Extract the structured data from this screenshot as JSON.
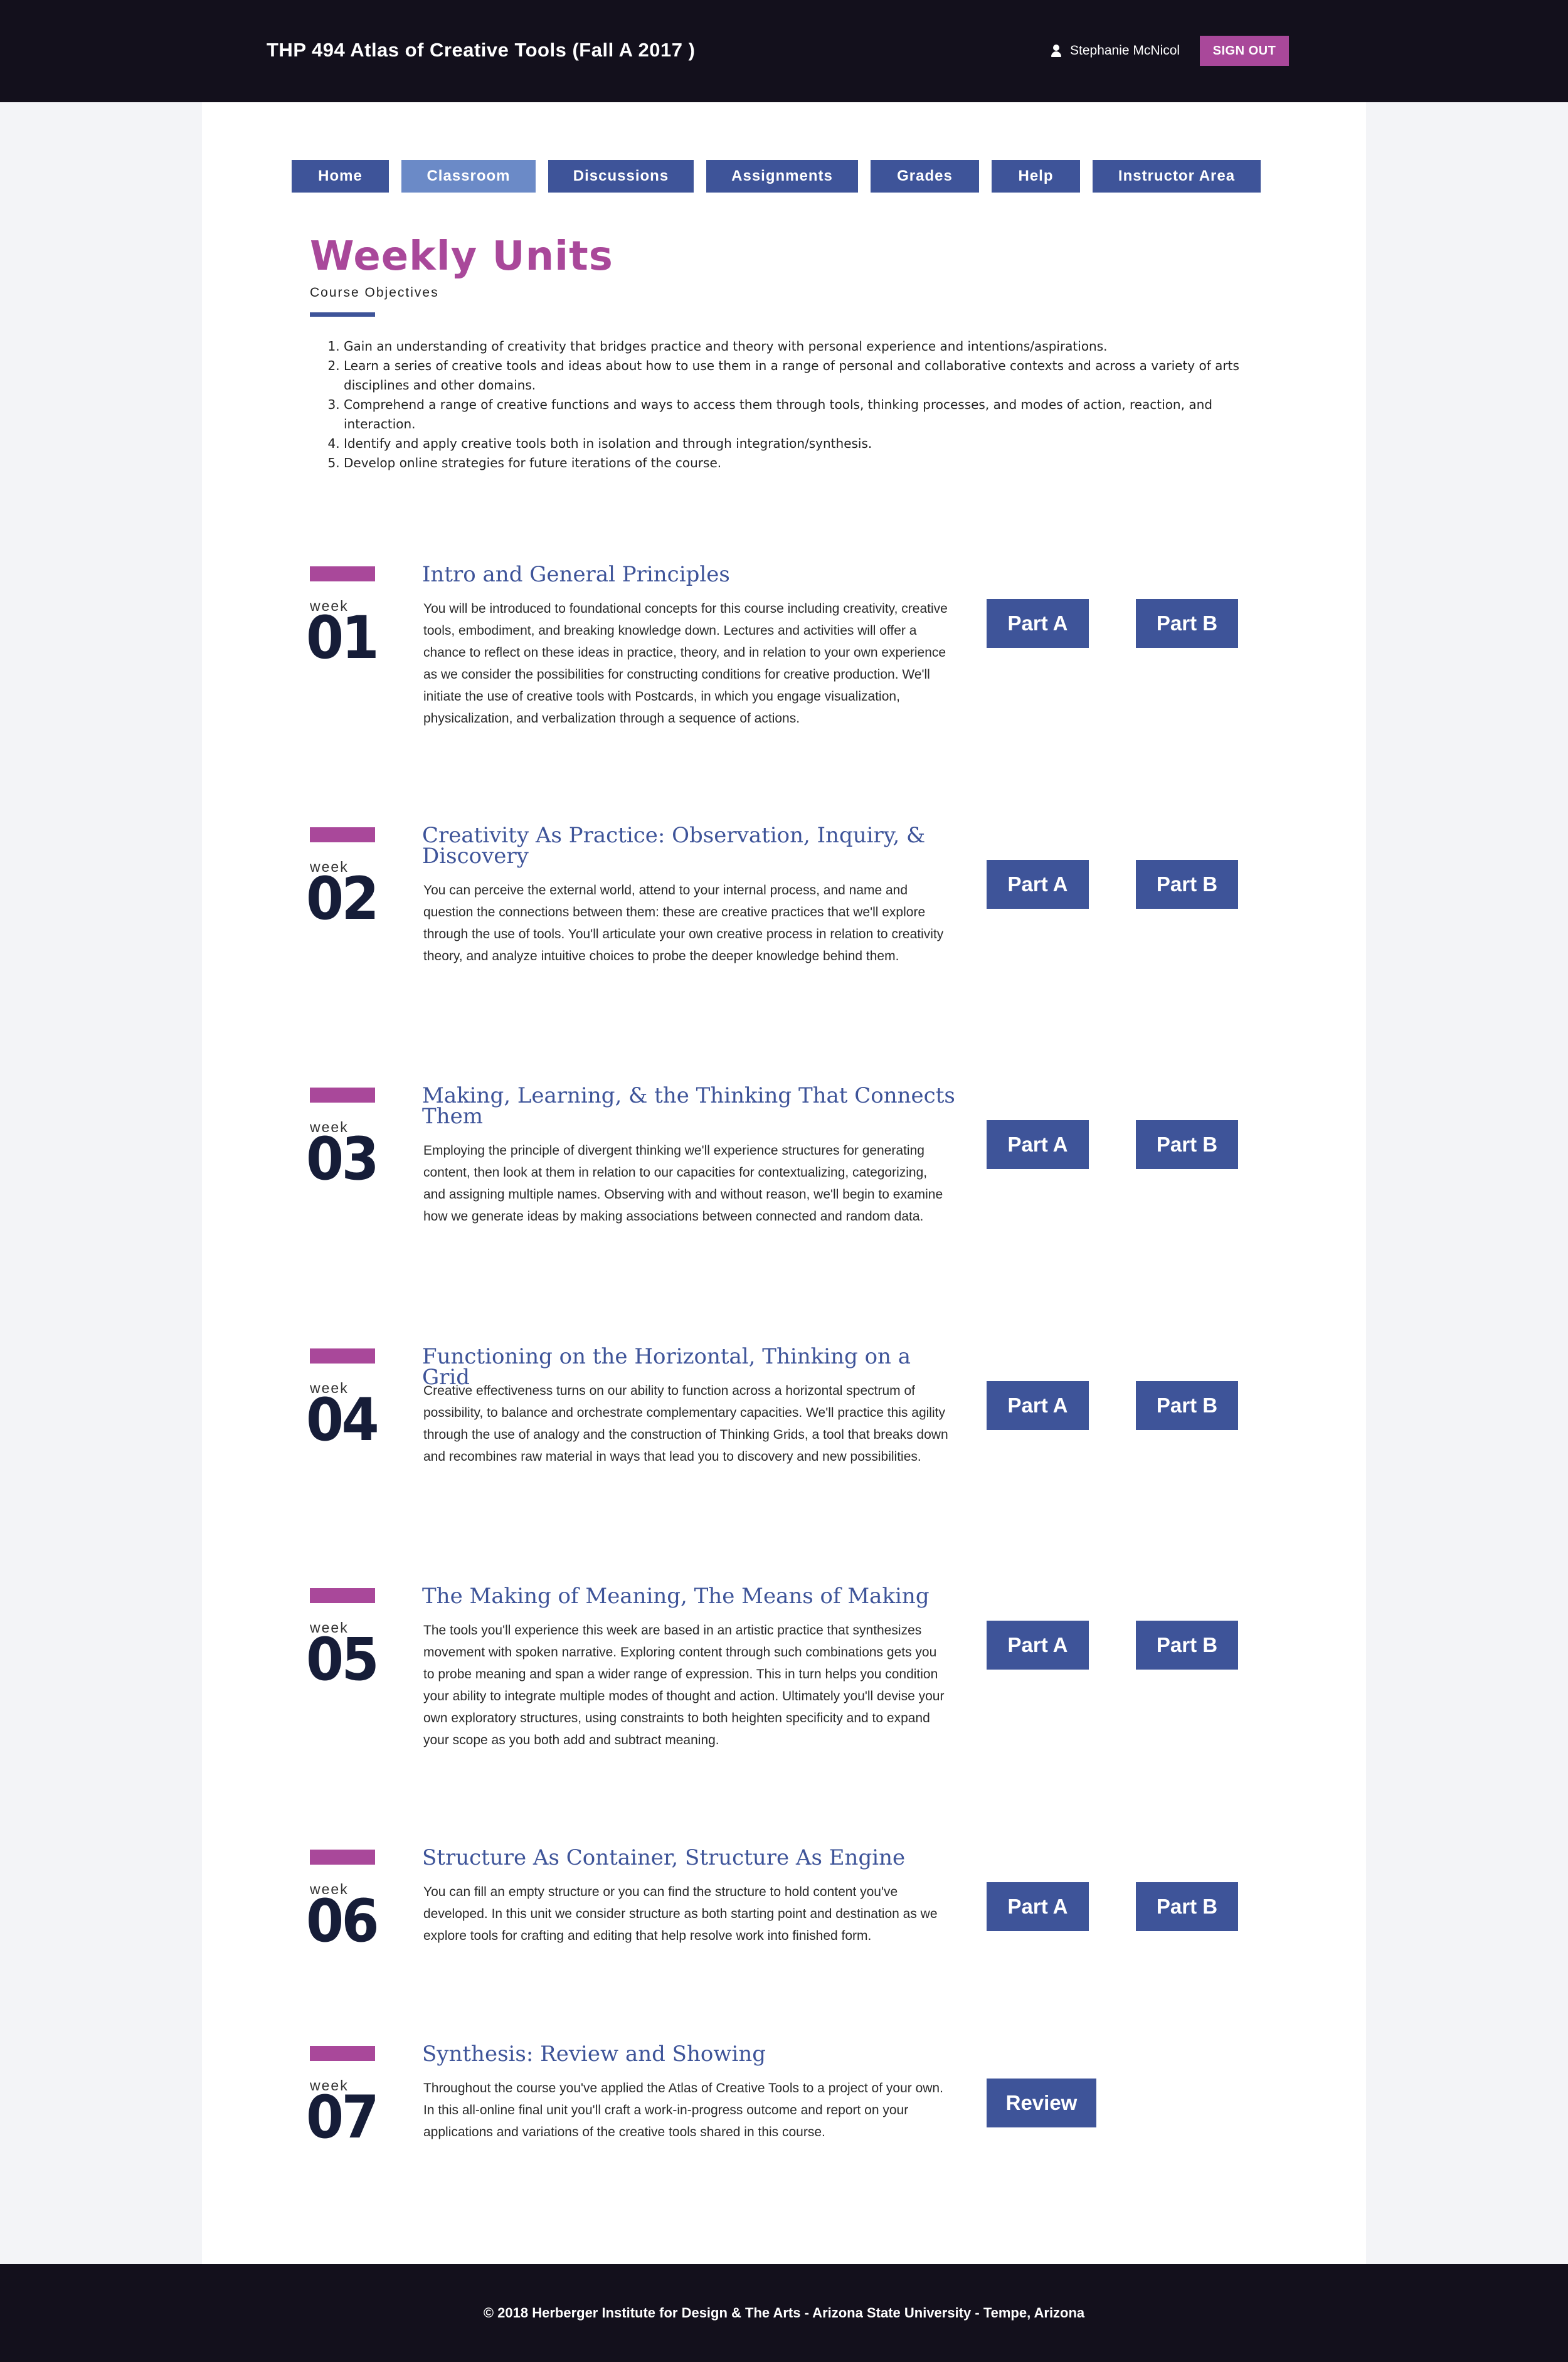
{
  "header": {
    "course_title": "THP 494 Atlas of Creative Tools (Fall A 2017 )",
    "user_name": "Stephanie McNicol",
    "user_icon": "user-icon",
    "sign_out_label": "SIGN OUT"
  },
  "nav": {
    "items": [
      "Home",
      "Classroom",
      "Discussions",
      "Assignments",
      "Grades",
      "Help",
      "Instructor Area"
    ],
    "active": "Classroom"
  },
  "page": {
    "title": "Weekly Units",
    "subtitle": "Course Objectives",
    "objectives": [
      "Gain an understanding of creativity that bridges practice and theory with personal experience and intentions/aspirations.",
      "Learn a series of creative tools and ideas about how to use them in a range of personal and collaborative contexts and across a variety of arts disciplines and other domains.",
      "Comprehend a range of creative functions and ways to access them through tools, thinking processes, and modes of action, reaction, and interaction.",
      "Identify and apply creative tools both in isolation and through integration/synthesis.",
      "Develop online strategies for future iterations of the course."
    ]
  },
  "units": [
    {
      "week_label": "week",
      "number": "01",
      "title": "Intro and General Principles",
      "description": "You will be introduced to foundational concepts for this course including creativity, creative tools, embodiment, and breaking knowledge down. Lectures and activities will offer a chance to reflect on these ideas in practice, theory, and in relation to your own experience as we consider the possibilities for constructing conditions for creative production. We'll initiate the use of creative tools with Postcards, in which you engage visualization, physicalization, and verbalization through a sequence of actions.",
      "buttons": [
        "Part A",
        "Part B"
      ]
    },
    {
      "week_label": "week",
      "number": "02",
      "title": "Creativity As Practice: Observation, Inquiry, & Discovery",
      "description": "You can perceive the external world, attend to your internal process, and name and question the connections between them: these are creative practices that we'll explore through the use of tools. You'll articulate your own creative process in relation to creativity theory, and analyze intuitive choices to probe the deeper knowledge behind them.",
      "buttons": [
        "Part A",
        "Part B"
      ]
    },
    {
      "week_label": "week",
      "number": "03",
      "title": "Making, Learning, & the Thinking That Connects Them",
      "description": "Employing the principle of divergent thinking we'll experience structures for generating content, then look at them in relation to our capacities for contextualizing, categorizing, and assigning multiple names. Observing with and without reason, we'll begin to examine how we generate ideas by making associations between connected and random data.",
      "buttons": [
        "Part A",
        "Part B"
      ]
    },
    {
      "week_label": "week",
      "number": "04",
      "title": "Functioning on the Horizontal, Thinking on a Grid",
      "description": "Creative effectiveness turns on our ability to function across a horizontal spectrum of possibility, to balance and orchestrate complementary capacities. We'll practice this agility through the use of analogy and the construction of Thinking Grids, a tool that breaks down and recombines raw material in ways that lead you to discovery and new possibilities.",
      "buttons": [
        "Part A",
        "Part B"
      ]
    },
    {
      "week_label": "week",
      "number": "05",
      "title": "The Making of Meaning, The Means of Making",
      "description": "The tools you'll experience this week are based in an artistic practice that synthesizes movement with spoken narrative. Exploring content through such combinations gets you to probe meaning and span a wider range of expression. This in turn helps you condition your ability to integrate multiple modes of thought and action. Ultimately you'll devise your own exploratory structures, using constraints to both heighten specificity and to expand your scope as you both add and subtract meaning.",
      "buttons": [
        "Part A",
        "Part B"
      ]
    },
    {
      "week_label": "week",
      "number": "06",
      "title": "Structure As Container, Structure As Engine",
      "description": "You can fill an empty structure or you can find the structure to hold content you've developed. In this unit we consider structure as both starting point and destination as we explore tools for crafting and editing that help resolve work into finished form.",
      "buttons": [
        "Part A",
        "Part B"
      ]
    },
    {
      "week_label": "week",
      "number": "07",
      "title": "Synthesis: Review and Showing",
      "description": "Throughout the course you've applied the Atlas of Creative Tools to a project of your own. In this all-online final unit you'll craft a work-in-progress outcome and report on your applications and variations of the creative tools shared in this course.",
      "buttons": [
        "Review"
      ]
    }
  ],
  "footer": {
    "text": "© 2018 Herberger Institute for Design & The Arts - Arizona State University - Tempe, Arizona"
  },
  "colors": {
    "header_bg": "#13101c",
    "accent_magenta": "#a9489a",
    "nav_blue": "#3e5499",
    "nav_active": "#6b8ac7",
    "week_number": "#161d38"
  }
}
